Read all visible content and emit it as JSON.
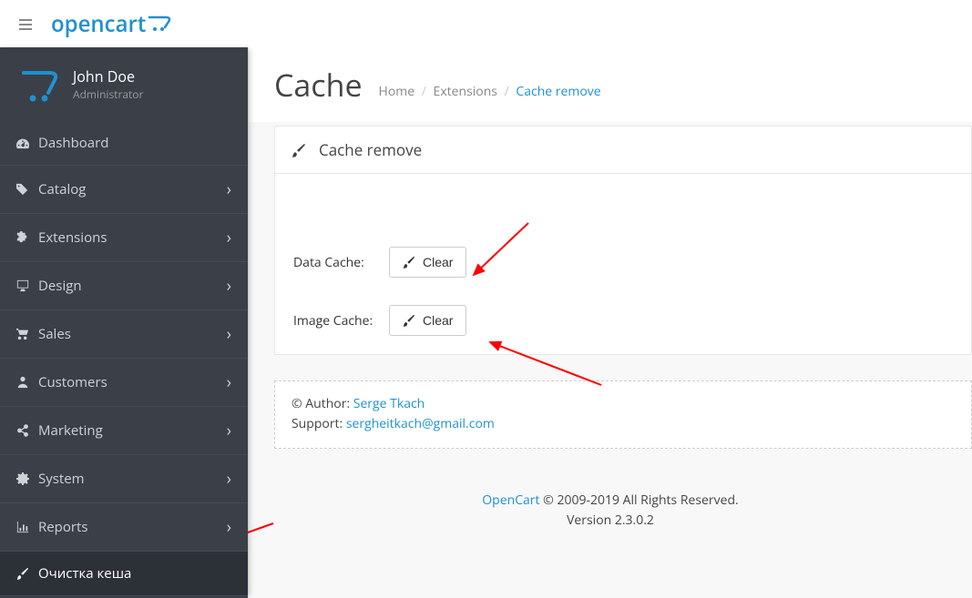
{
  "logo": "opencart",
  "user": {
    "name": "John Doe",
    "role": "Administrator"
  },
  "nav": [
    {
      "label": "Dashboard",
      "icon": "dashboard",
      "chevron": false
    },
    {
      "label": "Catalog",
      "icon": "tag",
      "chevron": true
    },
    {
      "label": "Extensions",
      "icon": "puzzle",
      "chevron": true
    },
    {
      "label": "Design",
      "icon": "desktop",
      "chevron": true
    },
    {
      "label": "Sales",
      "icon": "cart",
      "chevron": true
    },
    {
      "label": "Customers",
      "icon": "user",
      "chevron": true
    },
    {
      "label": "Marketing",
      "icon": "share",
      "chevron": true
    },
    {
      "label": "System",
      "icon": "cog",
      "chevron": true
    },
    {
      "label": "Reports",
      "icon": "chart",
      "chevron": true
    },
    {
      "label": "Очистка кеша",
      "icon": "brush",
      "chevron": false,
      "active": true
    }
  ],
  "page": {
    "title": "Cache",
    "breadcrumb": {
      "home": "Home",
      "ext": "Extensions",
      "current": "Cache remove"
    }
  },
  "panel": {
    "title": "Cache remove",
    "rows": [
      {
        "label": "Data Cache:",
        "button": "Clear"
      },
      {
        "label": "Image Cache:",
        "button": "Clear"
      }
    ]
  },
  "author": {
    "label": "© Author: ",
    "name": "Serge Tkach",
    "support_label": "Support: ",
    "support_email": "sergheitkach@gmail.com"
  },
  "footer": {
    "brand": "OpenCart",
    "copyright": " © 2009-2019 All Rights Reserved.",
    "version": "Version 2.3.0.2"
  }
}
